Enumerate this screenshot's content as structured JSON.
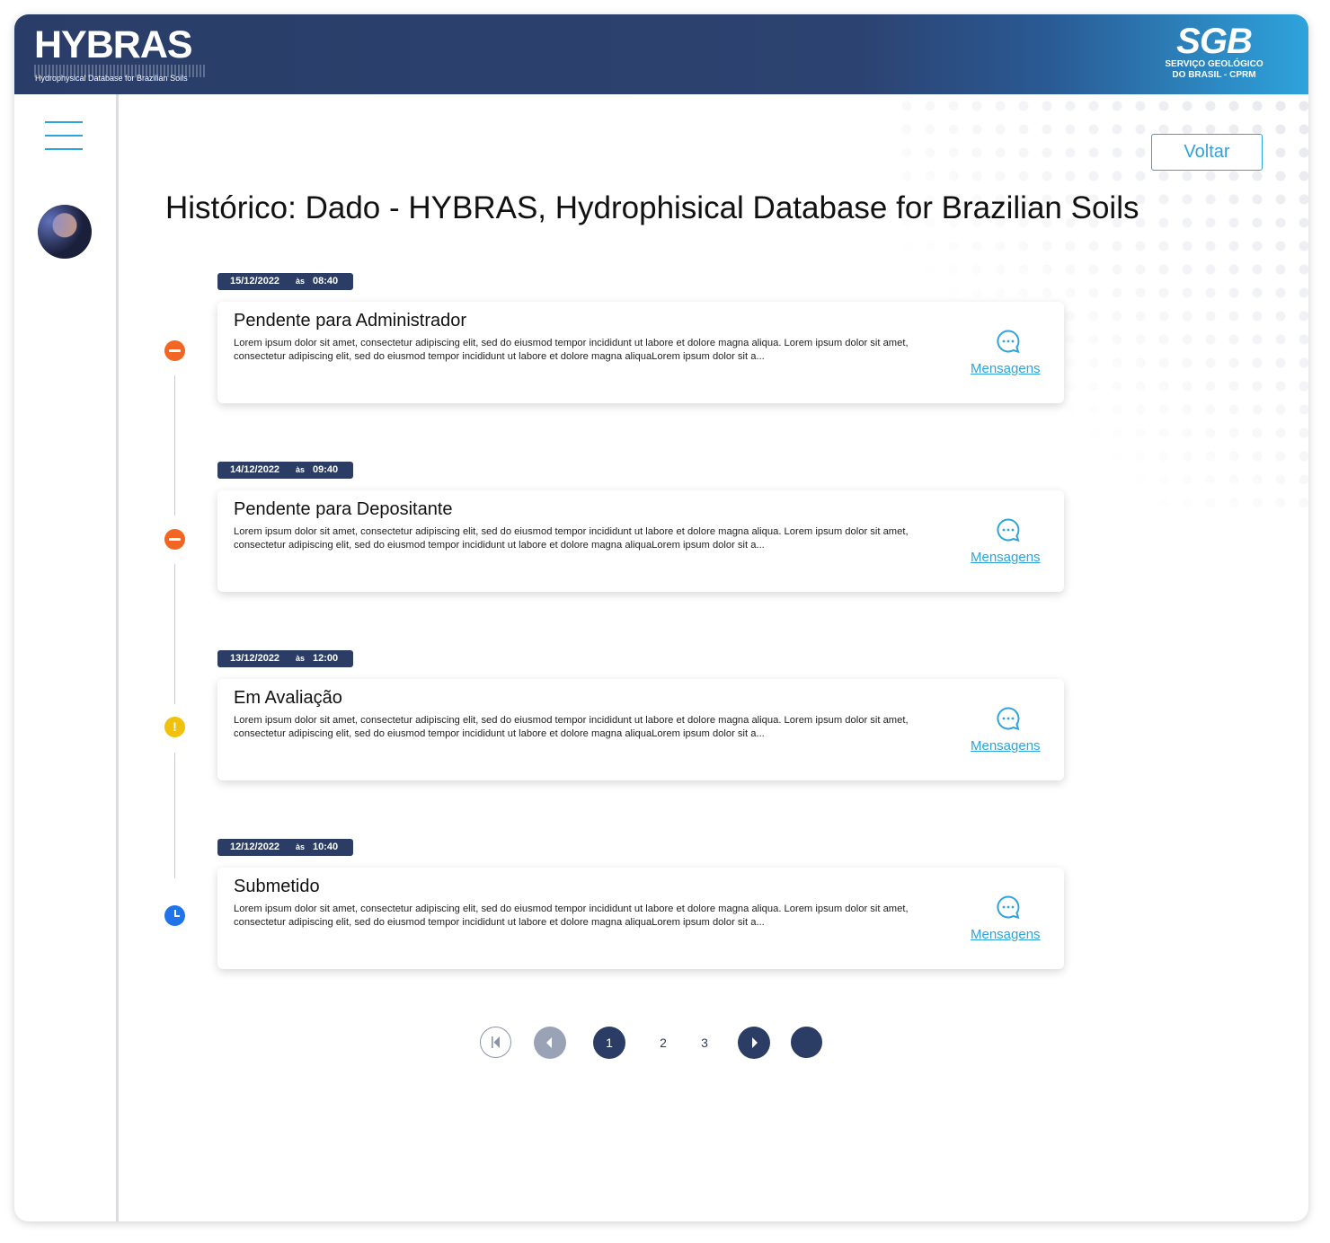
{
  "header": {
    "logo_text": "HYBRAS",
    "logo_subtitle": "Hydrophysical Database for Brazilian Soils",
    "partner_logo_text": "SGB",
    "partner_subtitle_line1": "SERVIÇO GEOLÓGICO",
    "partner_subtitle_line2": "DO BRASIL - CPRM"
  },
  "sidebar": {
    "menu_icon": "hamburger-icon",
    "avatar": "user-avatar"
  },
  "actions": {
    "back_label": "Voltar"
  },
  "page": {
    "title": "Histórico: Dado - HYBRAS, Hydrophisical Database for Brazilian Soils"
  },
  "timeline": [
    {
      "date": "15/12/2022",
      "sep": "às",
      "time": "08:40",
      "status_icon": "minus-circle-icon",
      "status_color": "#f26522",
      "title": "Pendente para Administrador",
      "text": "Lorem ipsum dolor sit amet, consectetur adipiscing elit, sed do eiusmod tempor incididunt ut labore et dolore magna aliqua. Lorem ipsum dolor sit amet, consectetur adipiscing elit, sed do eiusmod tempor incididunt ut labore et dolore magna aliquaLorem ipsum dolor sit a...",
      "link": "Mensagens"
    },
    {
      "date": "14/12/2022",
      "sep": "às",
      "time": "09:40",
      "status_icon": "minus-circle-icon",
      "status_color": "#f26522",
      "title": "Pendente para Depositante",
      "text": "Lorem ipsum dolor sit amet, consectetur adipiscing elit, sed do eiusmod tempor incididunt ut labore et dolore magna aliqua. Lorem ipsum dolor sit amet, consectetur adipiscing elit, sed do eiusmod tempor incididunt ut labore et dolore magna aliquaLorem ipsum dolor sit a...",
      "link": "Mensagens"
    },
    {
      "date": "13/12/2022",
      "sep": "às",
      "time": "12:00",
      "status_icon": "warning-circle-icon",
      "status_color": "#f0c20e",
      "title": "Em Avaliação",
      "text": "Lorem ipsum dolor sit amet, consectetur adipiscing elit, sed do eiusmod tempor incididunt ut labore et dolore magna aliqua. Lorem ipsum dolor sit amet, consectetur adipiscing elit, sed do eiusmod tempor incididunt ut labore et dolore magna aliquaLorem ipsum dolor sit a...",
      "link": "Mensagens"
    },
    {
      "date": "12/12/2022",
      "sep": "às",
      "time": "10:40",
      "status_icon": "clock-circle-icon",
      "status_color": "#1e74e8",
      "title": "Submetido",
      "text": "Lorem ipsum dolor sit amet, consectetur adipiscing elit, sed do eiusmod tempor incididunt ut labore et dolore magna aliqua. Lorem ipsum dolor sit amet, consectetur adipiscing elit, sed do eiusmod tempor incididunt ut labore et dolore magna aliquaLorem ipsum dolor sit a...",
      "link": "Mensagens"
    }
  ],
  "pagination": {
    "pages": [
      "1",
      "2",
      "3"
    ],
    "current": "1",
    "warning_glyph": "!"
  },
  "colors": {
    "accent": "#2ea3dc",
    "navy": "#2b3d65"
  }
}
